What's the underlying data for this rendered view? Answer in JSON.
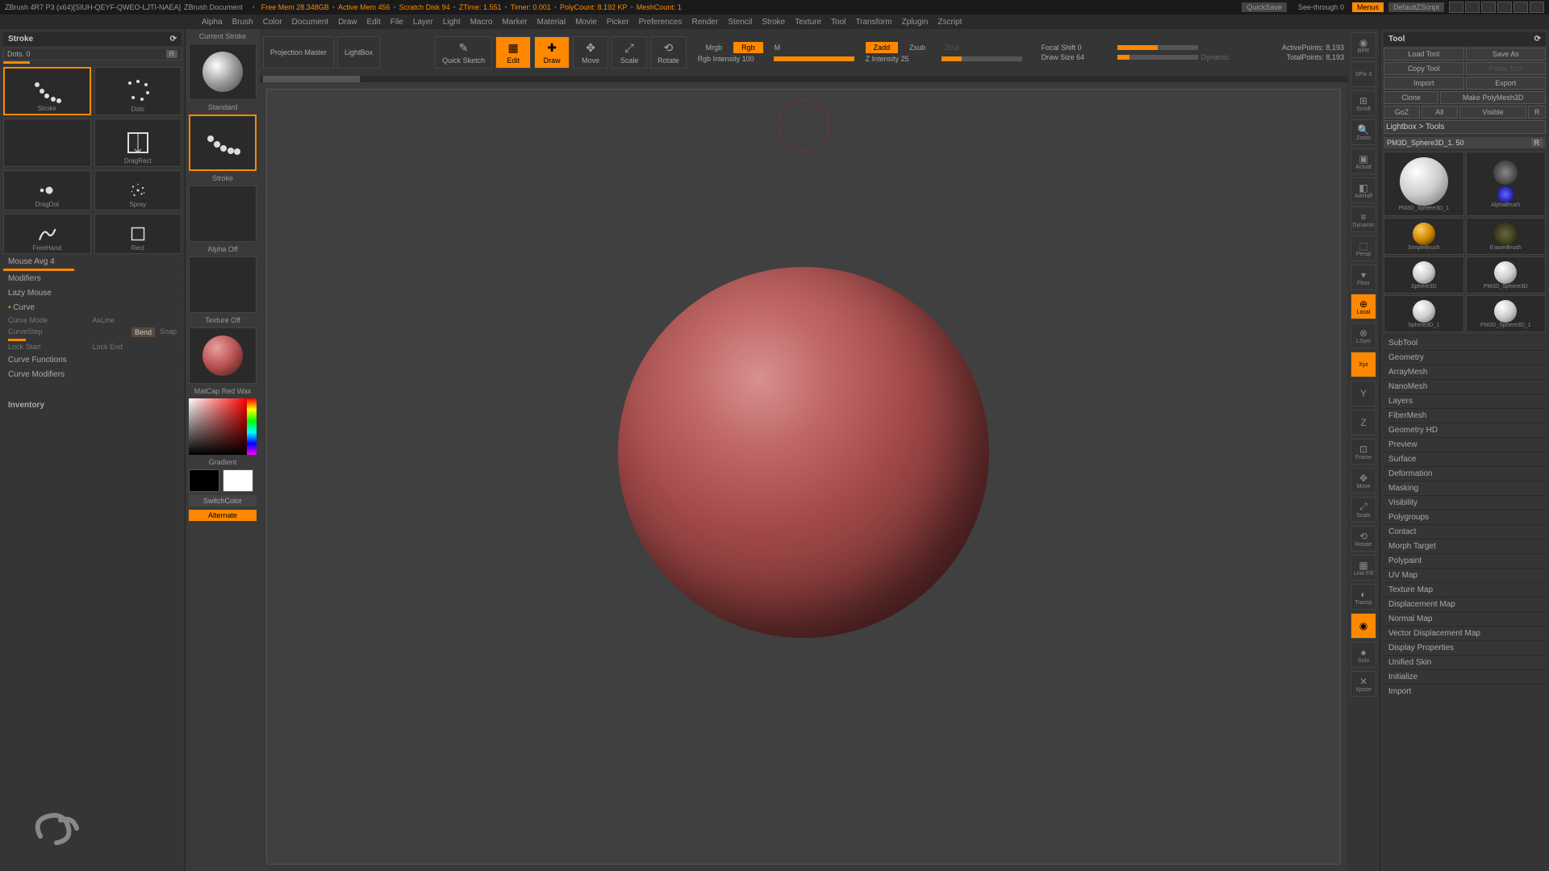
{
  "topbar": {
    "app": "ZBrush 4R7 P3 (x64)[SIUH-QEYF-QWEO-LJTI-NAEA]",
    "doc": "ZBrush Document",
    "stats": [
      "Free Mem  28.348GB",
      "Active Mem  456",
      "Scratch Disk  94",
      "ZTime: 1.551",
      "Timer: 0.001",
      "PolyCount: 8.192 KP",
      "MeshCount: 1"
    ],
    "quicksave": "QuickSave",
    "seethrough": "See-through  0",
    "menus": "Menus",
    "script": "DefaultZScript"
  },
  "menubar": {
    "items": [
      "Alpha",
      "Brush",
      "Color",
      "Document",
      "Draw",
      "Edit",
      "File",
      "Layer",
      "Light",
      "Macro",
      "Marker",
      "Material",
      "Movie",
      "Picker",
      "Preferences",
      "Render",
      "Stencil",
      "Stroke",
      "Texture",
      "Tool",
      "Transform",
      "Zplugin",
      "Zscript"
    ]
  },
  "leftPanel": {
    "title": "Stroke",
    "sub": "Dots. 0",
    "r": "R",
    "strokes": [
      {
        "label": "Stroke",
        "sel": true
      },
      {
        "label": "Dots"
      },
      {
        "label": "",
        "sel": false
      },
      {
        "label": "DragRect"
      },
      {
        "label": "DragDot"
      },
      {
        "label": "Spray"
      },
      {
        "label": "FreeHand"
      },
      {
        "label": "Rect"
      }
    ],
    "mouseAvg": "Mouse Avg 4",
    "modifiers": "Modifiers",
    "lazyMouse": "Lazy Mouse",
    "curve": "Curve",
    "curveMode": "Curve Mode",
    "asLine": "AsLine",
    "curveStep": "CurveStep",
    "bend": "Bend",
    "snap": "Snap",
    "lockStart": "Lock Start",
    "lockEnd": "Lock End",
    "curveFunc": "Curve Functions",
    "curveMod": "Curve Modifiers",
    "inventory": "Inventory"
  },
  "toolCol": {
    "currentStroke": "Current Stroke",
    "standard": "Standard",
    "stroke": "Stroke",
    "alphaOff": "Alpha Off",
    "textureOff": "Texture Off",
    "material": "MatCap Red Wax",
    "gradient": "Gradient",
    "switchColor": "SwitchColor",
    "alternate": "Alternate"
  },
  "toolbar": {
    "projection": "Projection Master",
    "lightbox": "LightBox",
    "quickSketch": "Quick Sketch",
    "edit": "Edit",
    "draw": "Draw",
    "move": "Move",
    "scale": "Scale",
    "rotate": "Rotate",
    "mrgb": "Mrgb",
    "rgb": "Rgb",
    "m": "M",
    "rgbInt": "Rgb Intensity 100",
    "zadd": "Zadd",
    "zsub": "Zsub",
    "zcut": "Zcut",
    "zInt": "Z Intensity 25",
    "focal": "Focal Shift 0",
    "drawSize": "Draw Size 64",
    "dynamic": "Dynamic",
    "activePoints": "ActivePoints: 8,193",
    "totalPoints": "TotalPoints: 8,193"
  },
  "iconStrip": [
    {
      "label": "BPR"
    },
    {
      "label": "SPix 3"
    },
    {
      "label": "Scroll"
    },
    {
      "label": "Zoom"
    },
    {
      "label": "Actual"
    },
    {
      "label": "AAHalf"
    },
    {
      "label": "Dynamic"
    },
    {
      "label": "Persp"
    },
    {
      "label": "Floor"
    },
    {
      "label": "Local",
      "active": true
    },
    {
      "label": "LSym"
    },
    {
      "label": "Xyz",
      "active": true
    },
    {
      "label": ""
    },
    {
      "label": ""
    },
    {
      "label": "Frame"
    },
    {
      "label": "Move"
    },
    {
      "label": "Scale"
    },
    {
      "label": "Rotate"
    },
    {
      "label": "Line Fill"
    },
    {
      "label": "Transp"
    },
    {
      "label": "",
      "active": true
    },
    {
      "label": "Solo"
    },
    {
      "label": "Xpose"
    }
  ],
  "rightPanel": {
    "title": "Tool",
    "loadTool": "Load Tool",
    "saveAs": "Save As",
    "copyTool": "Copy Tool",
    "pasteTool": "Paste Tool",
    "import": "Import",
    "export": "Export",
    "clone": "Clone",
    "makePoly": "Make PolyMesh3D",
    "goz": "GoZ",
    "all": "All",
    "visible": "Visible",
    "r": "R",
    "lightboxTools": "Lightbox > Tools",
    "toolName": "PM3D_Sphere3D_1. 50",
    "tools": [
      {
        "label": "PM3D_Sphere3D_1"
      },
      {
        "label": "AlphaBrush"
      },
      {
        "label": "SimpleBrush"
      },
      {
        "label": "EraserBrush"
      },
      {
        "label": "Sphere3D"
      },
      {
        "label": "PM3D_Sphere3D"
      },
      {
        "label": "Sphere3D_1"
      },
      {
        "label": "PM3D_Sphere3D_1"
      }
    ],
    "accordion": [
      "SubTool",
      "Geometry",
      "ArrayMesh",
      "NanoMesh",
      "Layers",
      "FiberMesh",
      "Geometry HD",
      "Preview",
      "Surface",
      "Deformation",
      "Masking",
      "Visibility",
      "Polygroups",
      "Contact",
      "Morph Target",
      "Polypaint",
      "UV Map",
      "Texture Map",
      "Displacement Map",
      "Normal Map",
      "Vector Displacement Map",
      "Display Properties",
      "Unified Skin",
      "Initialize",
      "Import"
    ]
  }
}
